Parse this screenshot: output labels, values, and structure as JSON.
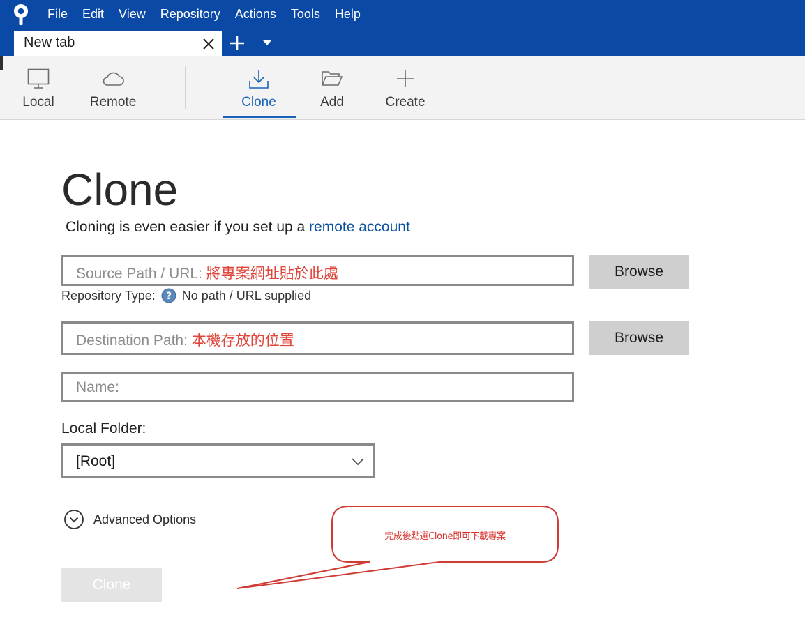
{
  "menubar": {
    "items": [
      "File",
      "Edit",
      "View",
      "Repository",
      "Actions",
      "Tools",
      "Help"
    ],
    "background": "#0a49a6"
  },
  "tabs": [
    {
      "label": "New tab"
    }
  ],
  "toolbar": {
    "local_label": "Local",
    "remote_label": "Remote",
    "clone_label": "Clone",
    "add_label": "Add",
    "create_label": "Create",
    "active_tab": "Clone",
    "accent": "#1a62b8"
  },
  "page": {
    "title": "Clone",
    "subtitle_prefix": "Cloning is even easier if you set up a ",
    "subtitle_link": "remote account"
  },
  "form": {
    "source_placeholder": "Source Path / URL:",
    "source_note": "將專案網址貼於此處",
    "browse_label": "Browse",
    "repo_type_label": "Repository Type:",
    "repo_type_value": "No path / URL supplied",
    "destination_placeholder": "Destination Path:",
    "destination_note": "本機存放的位置",
    "name_placeholder": "Name:",
    "local_folder_label": "Local Folder:",
    "local_folder_value": "[Root]",
    "advanced_label": "Advanced Options",
    "clone_button": "Clone"
  },
  "annotation": {
    "text": "完成後點選Clone即可下載專案",
    "color": "#d9322c"
  },
  "icons": {
    "logo": "sourcetree-logo-icon",
    "tab_close": "close-icon",
    "tab_add": "plus-icon",
    "tab_menu": "chevron-down-icon",
    "local": "monitor-icon",
    "remote": "cloud-icon",
    "clone": "download-icon",
    "add": "folder-open-icon",
    "create": "plus-icon",
    "repo_help": "help-icon",
    "select": "chevron-down-icon",
    "advanced": "circle-chevron-down-icon"
  }
}
